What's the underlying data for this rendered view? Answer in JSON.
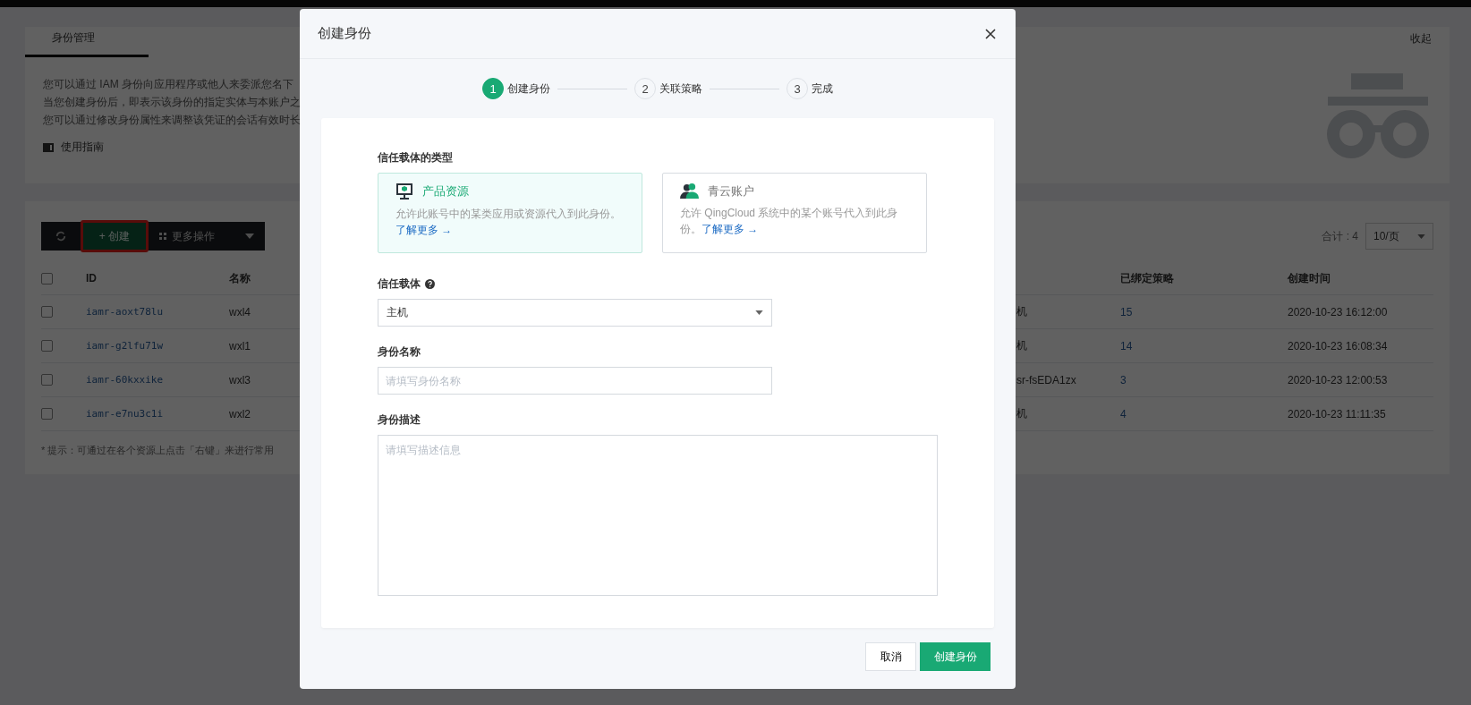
{
  "top_tabs": [
    {
      "label": "身份管理",
      "selected": true
    }
  ],
  "collapse_link": "收起",
  "intro": {
    "lines": [
      "您可以通过 IAM 身份向应用程序或他人来委派您名下",
      "当您创建身份后，即表示该身份的指定实体与本账户之",
      "您可以通过修改身份属性来调整该凭证的会话有效时长"
    ],
    "guide_link": "使用指南"
  },
  "toolbar": {
    "create_button": "+ 创建",
    "more_button": "更多操作"
  },
  "pagination": {
    "total": "合计 : 4",
    "page_size": "10/页"
  },
  "table": {
    "select_all_checked": false,
    "headers": {
      "id": "ID",
      "name": "名称",
      "policies": "已绑定策略",
      "created": "创建时间"
    },
    "rows": [
      {
        "checked": false,
        "id": "iamr-aoxt78lu",
        "name": "wxl4",
        "column_4": "机",
        "policies": "15",
        "created": "2020-10-23 16:12:00"
      },
      {
        "checked": false,
        "id": "iamr-g2lfu71w",
        "name": "wxl1",
        "column_4": "机",
        "policies": "14",
        "created": "2020-10-23 16:08:34"
      },
      {
        "checked": false,
        "id": "iamr-60kxxike",
        "name": "wxl3",
        "column_4": "sr-fsEDA1zx",
        "policies": "3",
        "created": "2020-10-23 12:00:53"
      },
      {
        "checked": false,
        "id": "iamr-e7nu3c1i",
        "name": "wxl2",
        "column_4": "机",
        "policies": "4",
        "created": "2020-10-23 11:11:35"
      }
    ]
  },
  "hint": "* 提示：可通过在各个资源上点击「右键」来进行常用",
  "dialog": {
    "title": "创建身份",
    "steps": [
      {
        "number": "1",
        "label": "创建身份",
        "active": true
      },
      {
        "number": "2",
        "label": "关联策略",
        "active": false
      },
      {
        "number": "3",
        "label": "完成",
        "active": false
      }
    ],
    "type_label": "信任载体的类型",
    "type_options": [
      {
        "kind": "resource",
        "title": "产品资源",
        "description": "允许此账号中的某类应用或资源代入到此身份。",
        "link": "了解更多 →",
        "selected": true
      },
      {
        "kind": "account",
        "title": "青云账户",
        "description": "允许 QingCloud 系统中的某个账号代入到此身份。",
        "link": "了解更多 →",
        "selected": false
      }
    ],
    "carrier": {
      "label": "信任载体",
      "value": "主机"
    },
    "name_field": {
      "label": "身份名称",
      "placeholder": "请填写身份名称"
    },
    "desc_field": {
      "label": "身份描述",
      "placeholder": "请填写描述信息"
    },
    "cancel_button": "取消",
    "submit_button": "创建身份"
  }
}
